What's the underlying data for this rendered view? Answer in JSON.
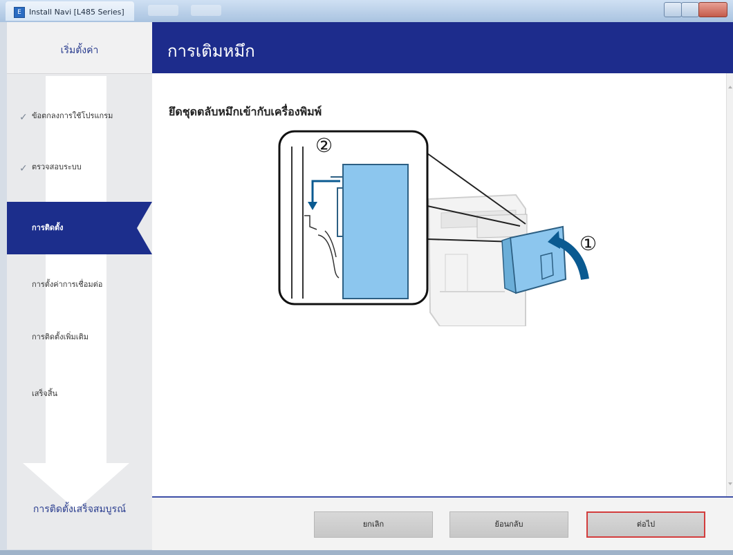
{
  "window": {
    "title": "Install Navi [L485 Series]",
    "icon_name": "install-navi-app-icon",
    "controls": [
      "minimize-icon",
      "maximize-icon",
      "close-icon"
    ]
  },
  "sidebar": {
    "header_label": "เริ่มตั้งค่า",
    "steps": [
      {
        "label": "ข้อตกลงการใช้โปรแกรม",
        "state": "done"
      },
      {
        "label": "ตรวจสอบระบบ",
        "state": "done"
      },
      {
        "label": "การติดตั้ง",
        "state": "active"
      },
      {
        "label": "การตั้งค่าการเชื่อมต่อ",
        "state": "pending"
      },
      {
        "label": "การติดตั้งเพิ่มเติม",
        "state": "pending"
      },
      {
        "label": "เสร็จสิ้น",
        "state": "pending"
      }
    ],
    "footer_label": "การติดตั้งเสร็จสมบูรณ์",
    "check_mark": "✓"
  },
  "header": {
    "title": "การเติมหมึก"
  },
  "main": {
    "instruction": "ยึดชุดตลับหมึกเข้ากับเครื่องพิมพ์",
    "illustration": {
      "callouts": [
        "①",
        "②"
      ],
      "icon_name": "ink-tank-attach-illustration"
    }
  },
  "footer": {
    "cancel_label": "ยกเลิก",
    "back_label": "ย้อนกลับ",
    "next_label": "ต่อไป"
  },
  "colors": {
    "brand_navy": "#1d2c8c",
    "ink_tank_blue": "#8cc6ee",
    "arrow_blue": "#0a5a91",
    "highlight_red": "#d33c3c"
  }
}
